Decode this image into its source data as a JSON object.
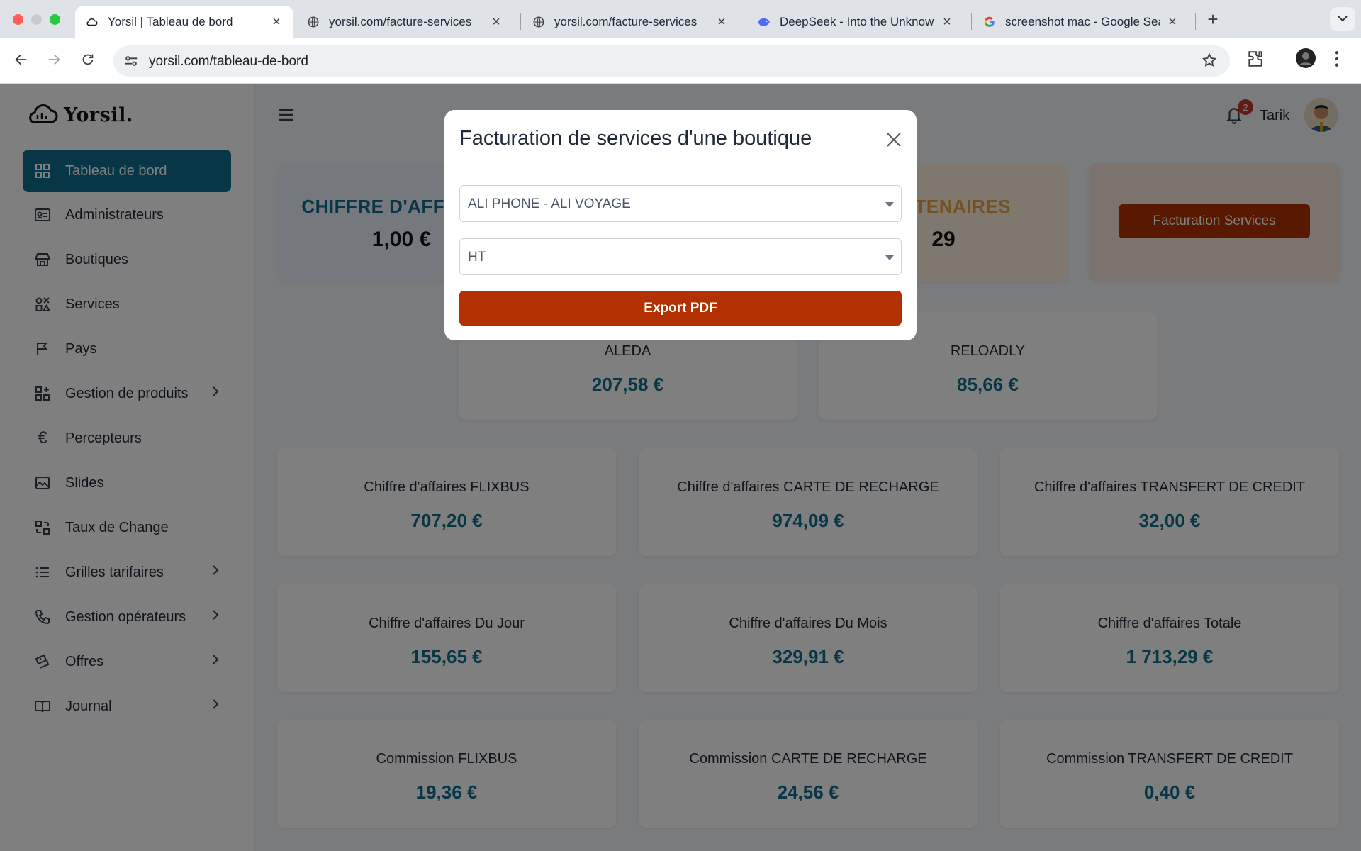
{
  "browser": {
    "tabs": [
      {
        "title": "Yorsil | Tableau de bord",
        "favicon": "cloud-icon",
        "active": true
      },
      {
        "title": "yorsil.com/facture-services",
        "favicon": "globe-icon",
        "active": false
      },
      {
        "title": "yorsil.com/facture-services",
        "favicon": "globe-icon",
        "active": false
      },
      {
        "title": "DeepSeek - Into the Unknown",
        "favicon": "whale-icon",
        "active": false
      },
      {
        "title": "screenshot mac - Google Search",
        "favicon": "google-icon",
        "active": false
      }
    ],
    "url": "yorsil.com/tableau-de-bord"
  },
  "brand": {
    "name": "Yorsil.",
    "accent": "#0f6e8c"
  },
  "sidebar": {
    "items": [
      {
        "label": "Tableau de bord",
        "icon": "dashboard-icon",
        "active": true,
        "submenu": false
      },
      {
        "label": "Administrateurs",
        "icon": "id-card-icon",
        "active": false,
        "submenu": false
      },
      {
        "label": "Boutiques",
        "icon": "store-icon",
        "active": false,
        "submenu": false
      },
      {
        "label": "Services",
        "icon": "services-icon",
        "active": false,
        "submenu": false
      },
      {
        "label": "Pays",
        "icon": "flag-icon",
        "active": false,
        "submenu": false
      },
      {
        "label": "Gestion de produits",
        "icon": "grid-plus-icon",
        "active": false,
        "submenu": true
      },
      {
        "label": "Percepteurs",
        "icon": "euro-icon",
        "active": false,
        "submenu": false
      },
      {
        "label": "Slides",
        "icon": "image-icon",
        "active": false,
        "submenu": false
      },
      {
        "label": "Taux de Change",
        "icon": "exchange-icon",
        "active": false,
        "submenu": false
      },
      {
        "label": "Grilles tarifaires",
        "icon": "list-icon",
        "active": false,
        "submenu": true
      },
      {
        "label": "Gestion opérateurs",
        "icon": "phone-icon",
        "active": false,
        "submenu": true
      },
      {
        "label": "Offres",
        "icon": "offers-icon",
        "active": false,
        "submenu": true
      },
      {
        "label": "Journal",
        "icon": "book-icon",
        "active": false,
        "submenu": true
      }
    ]
  },
  "header": {
    "user": "Tarik",
    "notifications": "2"
  },
  "top_cards": {
    "ca": {
      "label": "CHIFFRE D'AFFAIRES",
      "value": "1,00 €"
    },
    "partners": {
      "label": "PARTENAIRES",
      "value": "29"
    },
    "facturation_button": "Facturation Services"
  },
  "providers": [
    {
      "label": "ALEDA",
      "value": "207,58 €"
    },
    {
      "label": "RELOADLY",
      "value": "85,66 €"
    }
  ],
  "stats": [
    {
      "label": "Chiffre d'affaires FLIXBUS",
      "value": "707,20 €"
    },
    {
      "label": "Chiffre d'affaires CARTE DE RECHARGE",
      "value": "974,09 €"
    },
    {
      "label": "Chiffre d'affaires TRANSFERT DE CREDIT",
      "value": "32,00 €"
    },
    {
      "label": "Chiffre d'affaires Du Jour",
      "value": "155,65 €"
    },
    {
      "label": "Chiffre d'affaires Du Mois",
      "value": "329,91 €"
    },
    {
      "label": "Chiffre d'affaires Totale",
      "value": "1 713,29 €"
    },
    {
      "label": "Commission FLIXBUS",
      "value": "19,36 €"
    },
    {
      "label": "Commission CARTE DE RECHARGE",
      "value": "24,56 €"
    },
    {
      "label": "Commission TRANSFERT DE CREDIT",
      "value": "0,40 €"
    }
  ],
  "modal": {
    "title": "Facturation de services d'une boutique",
    "shop_select": "ALI PHONE - ALI VOYAGE",
    "tax_select": "HT",
    "export_label": "Export PDF",
    "button_color": "#b33000"
  }
}
